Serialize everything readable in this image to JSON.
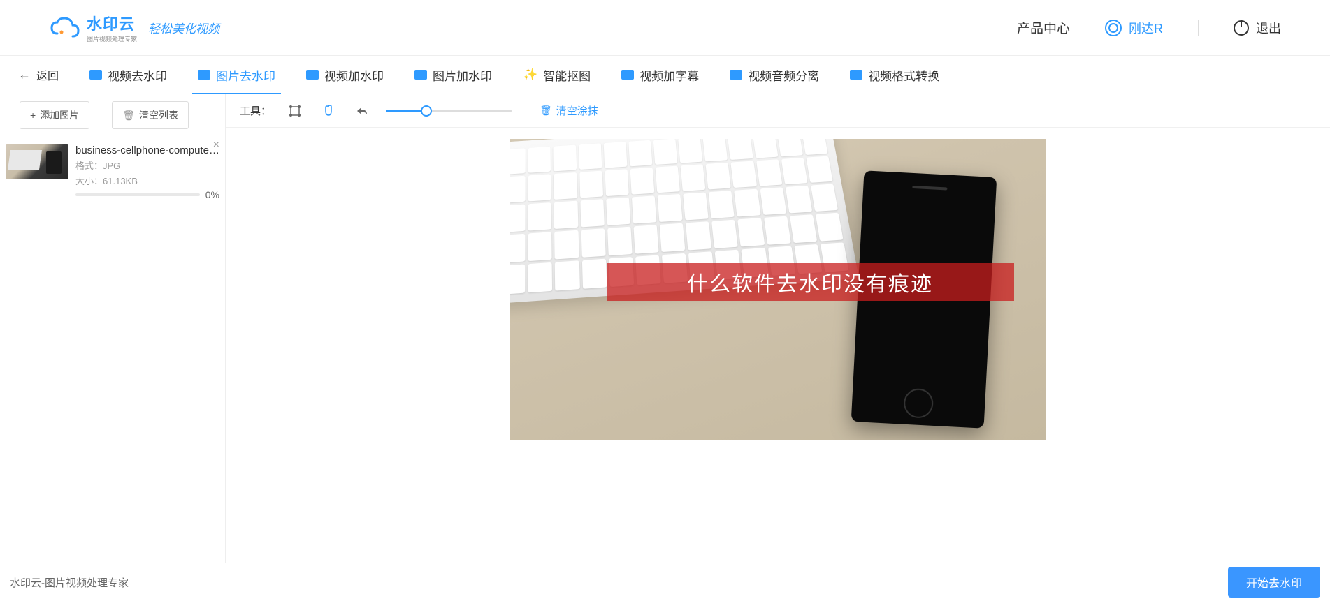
{
  "header": {
    "logo_title": "水印云",
    "logo_sub": "图片视频处理专家",
    "slogan": "轻松美化视频",
    "product_center": "产品中心",
    "user_name": "刚达R",
    "logout": "退出"
  },
  "nav": {
    "back": "返回",
    "tabs": [
      {
        "label": "视频去水印"
      },
      {
        "label": "图片去水印"
      },
      {
        "label": "视频加水印"
      },
      {
        "label": "图片加水印"
      },
      {
        "label": "智能抠图"
      },
      {
        "label": "视频加字幕"
      },
      {
        "label": "视频音频分离"
      },
      {
        "label": "视频格式转换"
      }
    ],
    "active_index": 1
  },
  "sidebar": {
    "add_btn": "添加图片",
    "clear_btn": "清空列表",
    "files": [
      {
        "name": "business-cellphone-computer...",
        "format_label": "格式：",
        "format_value": "JPG",
        "size_label": "大小：",
        "size_value": "61.13KB",
        "progress": "0%"
      }
    ]
  },
  "toolbar": {
    "label": "工具：",
    "clear_smear": "清空涂抹",
    "slider_percent": 32
  },
  "canvas": {
    "watermark_text": "什么软件去水印没有痕迹"
  },
  "footer": {
    "brand": "水印云-图片视频处理专家",
    "start_btn": "开始去水印"
  }
}
